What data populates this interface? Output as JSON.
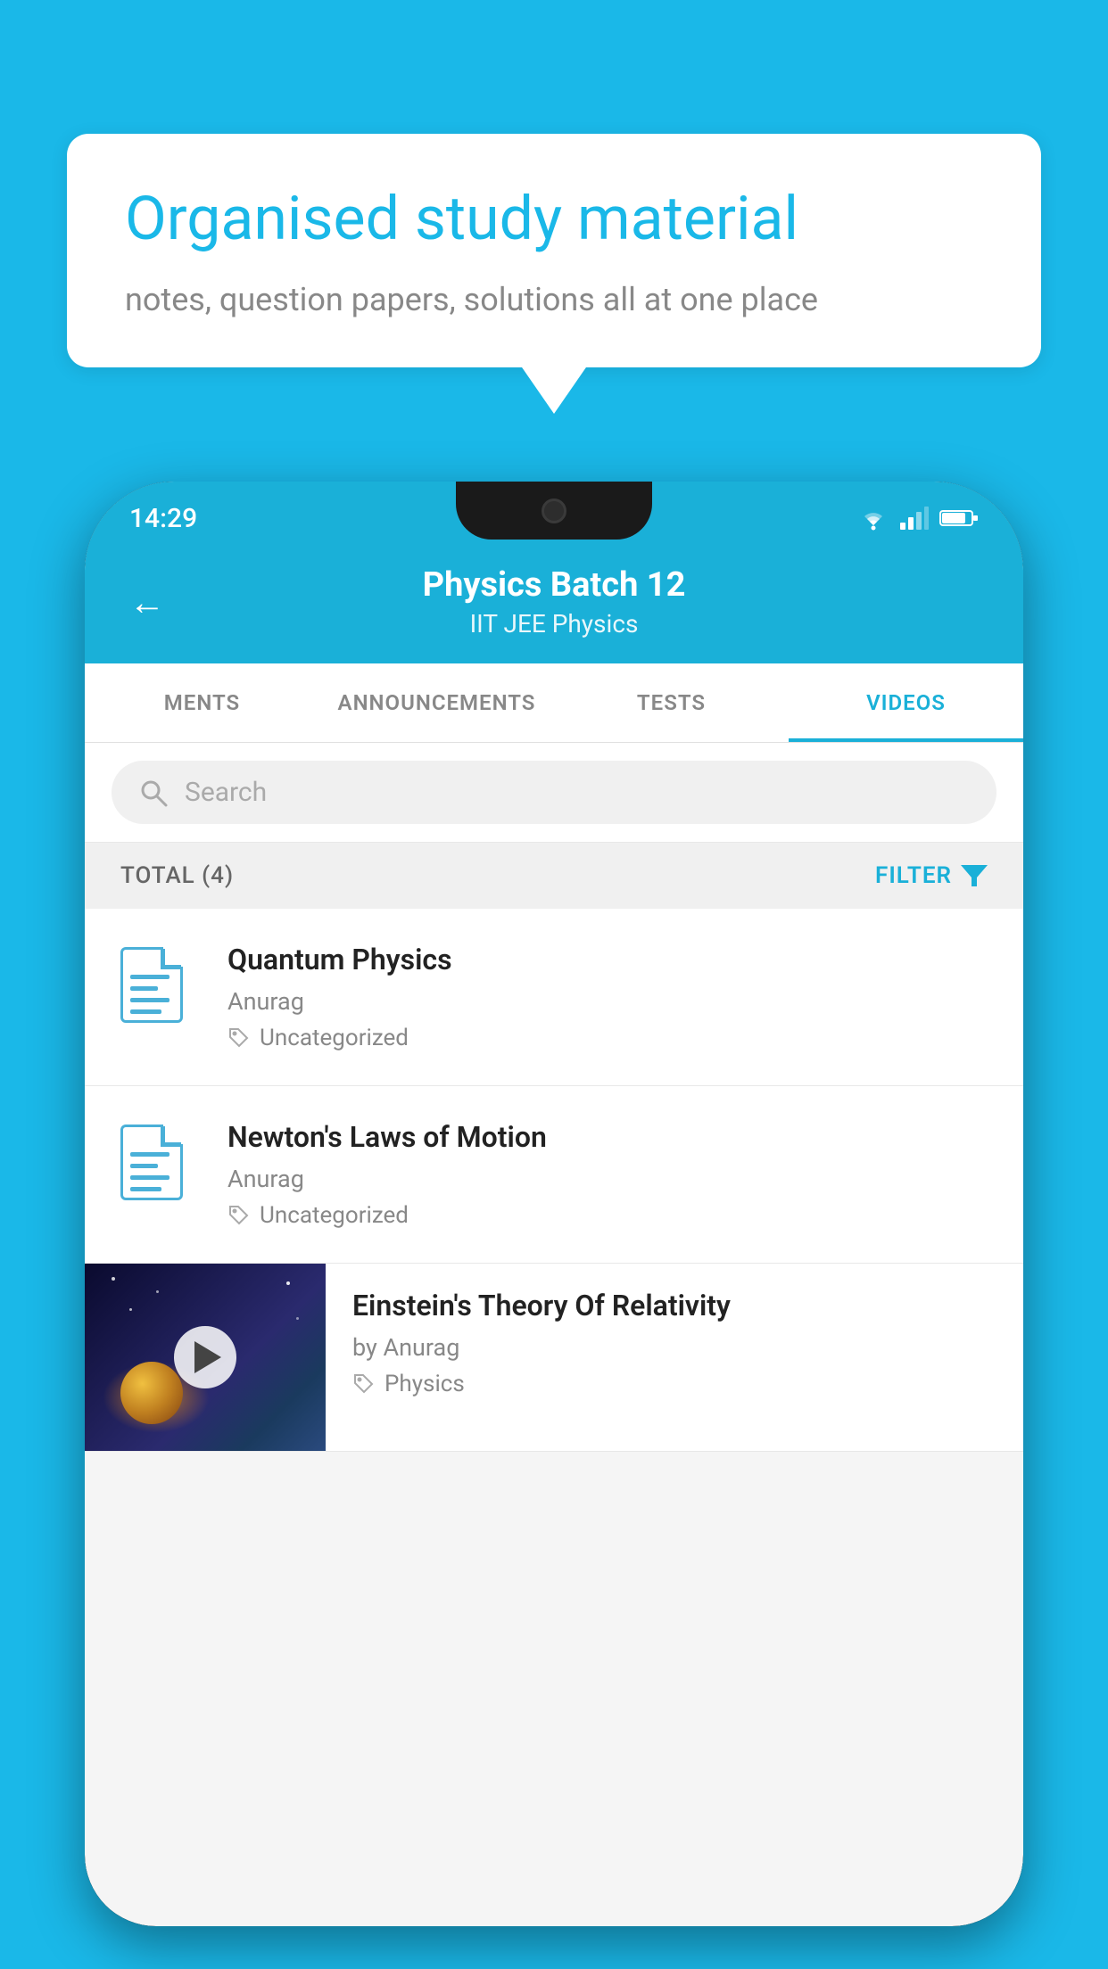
{
  "background_color": "#1ab8e8",
  "speech_bubble": {
    "title": "Organised study material",
    "subtitle": "notes, question papers, solutions all at one place"
  },
  "status_bar": {
    "time": "14:29",
    "wifi": "▼",
    "signal": "▲",
    "battery": ""
  },
  "header": {
    "back_label": "←",
    "title": "Physics Batch 12",
    "subtitle": "IIT JEE   Physics"
  },
  "tabs": [
    {
      "label": "MENTS",
      "active": false
    },
    {
      "label": "ANNOUNCEMENTS",
      "active": false
    },
    {
      "label": "TESTS",
      "active": false
    },
    {
      "label": "VIDEOS",
      "active": true
    }
  ],
  "search": {
    "placeholder": "Search"
  },
  "filter_bar": {
    "total_label": "TOTAL (4)",
    "filter_label": "FILTER"
  },
  "videos": [
    {
      "id": "quantum-physics",
      "title": "Quantum Physics",
      "author": "Anurag",
      "tag": "Uncategorized",
      "has_thumb": false
    },
    {
      "id": "newtons-laws",
      "title": "Newton's Laws of Motion",
      "author": "Anurag",
      "tag": "Uncategorized",
      "has_thumb": false
    },
    {
      "id": "einstein-relativity",
      "title": "Einstein's Theory Of Relativity",
      "author": "by Anurag",
      "tag": "Physics",
      "has_thumb": true
    }
  ]
}
